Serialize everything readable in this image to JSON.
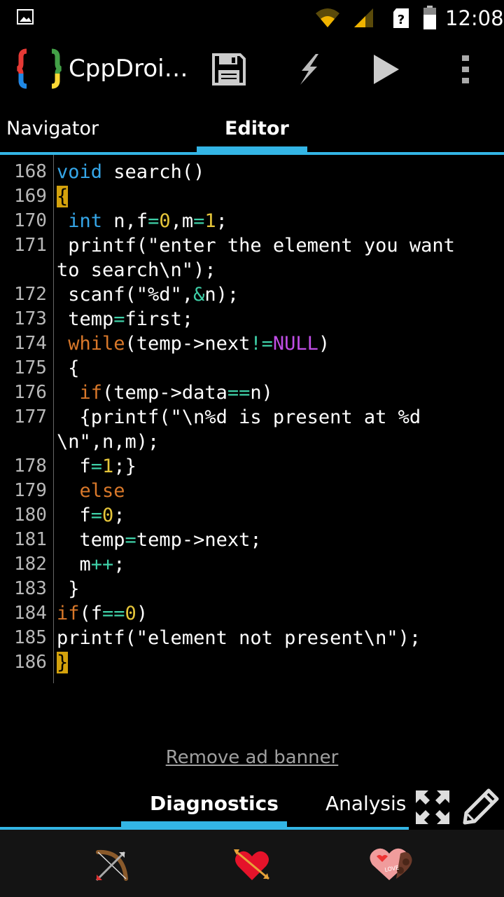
{
  "status_bar": {
    "time": "12:08"
  },
  "app_bar": {
    "title": "CppDroi…"
  },
  "tabs": {
    "navigator": "Navigator",
    "editor": "Editor",
    "active": "Editor"
  },
  "editor": {
    "lines": [
      {
        "num": "168",
        "code": "void search()"
      },
      {
        "num": "169",
        "code": "{"
      },
      {
        "num": "170",
        "code": " int n,f=0,m=1;"
      },
      {
        "num": "171",
        "code": " printf(\"enter the element you want"
      },
      {
        "num": "",
        "code": "to search\\n\");"
      },
      {
        "num": "172",
        "code": " scanf(\"%d\",&n);"
      },
      {
        "num": "173",
        "code": " temp=first;"
      },
      {
        "num": "174",
        "code": " while(temp->next!=NULL)"
      },
      {
        "num": "175",
        "code": " {"
      },
      {
        "num": "176",
        "code": "  if(temp->data==n)"
      },
      {
        "num": "177",
        "code": "  {printf(\"\\n%d is present at %d"
      },
      {
        "num": "",
        "code": "\\n\",n,m);"
      },
      {
        "num": "178",
        "code": "  f=1;}"
      },
      {
        "num": "179",
        "code": "  else"
      },
      {
        "num": "180",
        "code": "  f=0;"
      },
      {
        "num": "181",
        "code": "  temp=temp->next;"
      },
      {
        "num": "182",
        "code": "  m++;"
      },
      {
        "num": "183",
        "code": " }"
      },
      {
        "num": "184",
        "code": "if(f==0)"
      },
      {
        "num": "185",
        "code": "printf(\"element not present\\n\");"
      },
      {
        "num": "186",
        "code": "}"
      }
    ]
  },
  "ad": {
    "remove_label": "Remove ad banner"
  },
  "bottom_tabs": {
    "diagnostics": "Diagnostics",
    "analysis": "Analysis",
    "active": "Diagnostics"
  },
  "icons": {
    "status": [
      "image-icon",
      "wifi-icon",
      "signal-icon",
      "help-icon",
      "battery-icon"
    ],
    "toolbar": [
      "save-icon",
      "flash-icon",
      "run-icon",
      "more-icon"
    ],
    "bottom": [
      "expand-icon",
      "edit-icon"
    ],
    "nav": [
      "bow-arrow-icon",
      "heart-arrow-icon",
      "love-chocolate-icon"
    ]
  },
  "colors": {
    "accent": "#33b5e5",
    "keyword_type": "#35a6e8",
    "keyword_control": "#d9782a",
    "number": "#e5c53a",
    "operator": "#3fd0a8",
    "null": "#c04ee6",
    "brace_highlight": "#d4a20c"
  }
}
